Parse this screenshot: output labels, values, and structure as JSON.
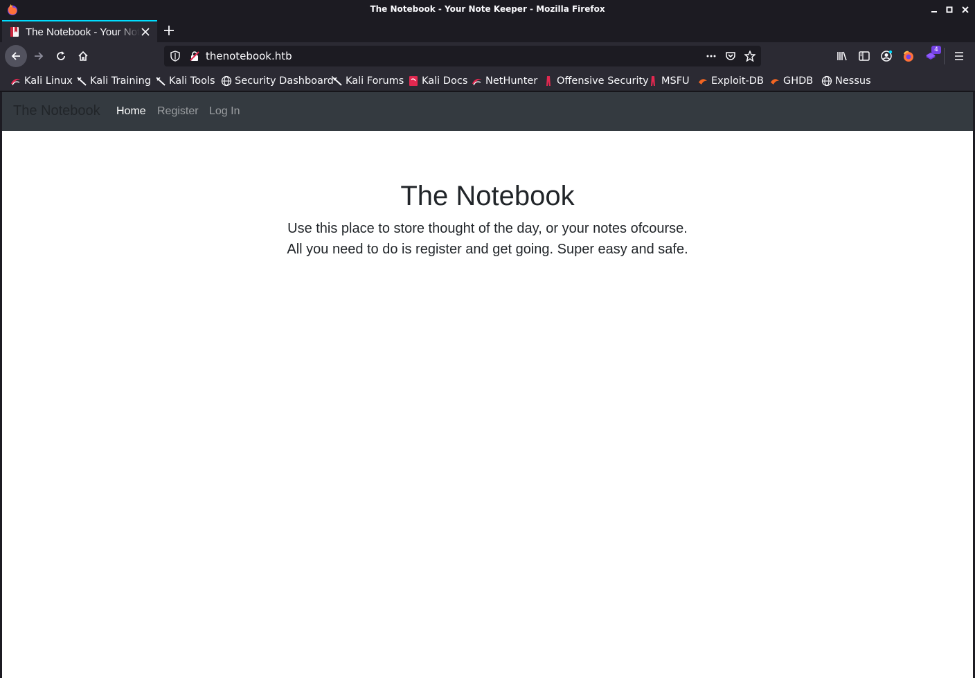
{
  "window": {
    "title": "The Notebook - Your Note Keeper - Mozilla Firefox"
  },
  "tabs": [
    {
      "label": "The Notebook - Your Note Keeper",
      "active": true
    }
  ],
  "urlbar": {
    "url": "thenotebook.htb"
  },
  "extensions": {
    "badge_count": "4"
  },
  "bookmarks": [
    {
      "label": "Kali Linux",
      "icon": "kali-dragon-icon"
    },
    {
      "label": "Kali Training",
      "icon": "kali-sword-icon"
    },
    {
      "label": "Kali Tools",
      "icon": "kali-sword-icon"
    },
    {
      "label": "Security Dashboard",
      "icon": "globe-icon"
    },
    {
      "label": "Kali Forums",
      "icon": "kali-sword-icon"
    },
    {
      "label": "Kali Docs",
      "icon": "kali-docs-icon"
    },
    {
      "label": "NetHunter",
      "icon": "kali-dragon-icon"
    },
    {
      "label": "Offensive Security",
      "icon": "offsec-icon"
    },
    {
      "label": "MSFU",
      "icon": "offsec-icon"
    },
    {
      "label": "Exploit-DB",
      "icon": "exploitdb-icon"
    },
    {
      "label": "GHDB",
      "icon": "exploitdb-icon"
    },
    {
      "label": "Nessus",
      "icon": "globe-icon"
    }
  ],
  "site": {
    "brand": "The Notebook",
    "nav": [
      {
        "label": "Home",
        "active": true
      },
      {
        "label": "Register",
        "active": false
      },
      {
        "label": "Log In",
        "active": false
      }
    ],
    "heading": "The Notebook",
    "lines": [
      "Use this place to store thought of the day, or your notes ofcourse.",
      "All you need to do is register and get going. Super easy and safe."
    ]
  },
  "colors": {
    "chrome_dark": "#1c1b22",
    "chrome": "#2b2a33",
    "tab_accent": "#00ddff",
    "site_navbar": "#343a40",
    "page_bg": "#ffffff",
    "text_dark": "#212529"
  }
}
